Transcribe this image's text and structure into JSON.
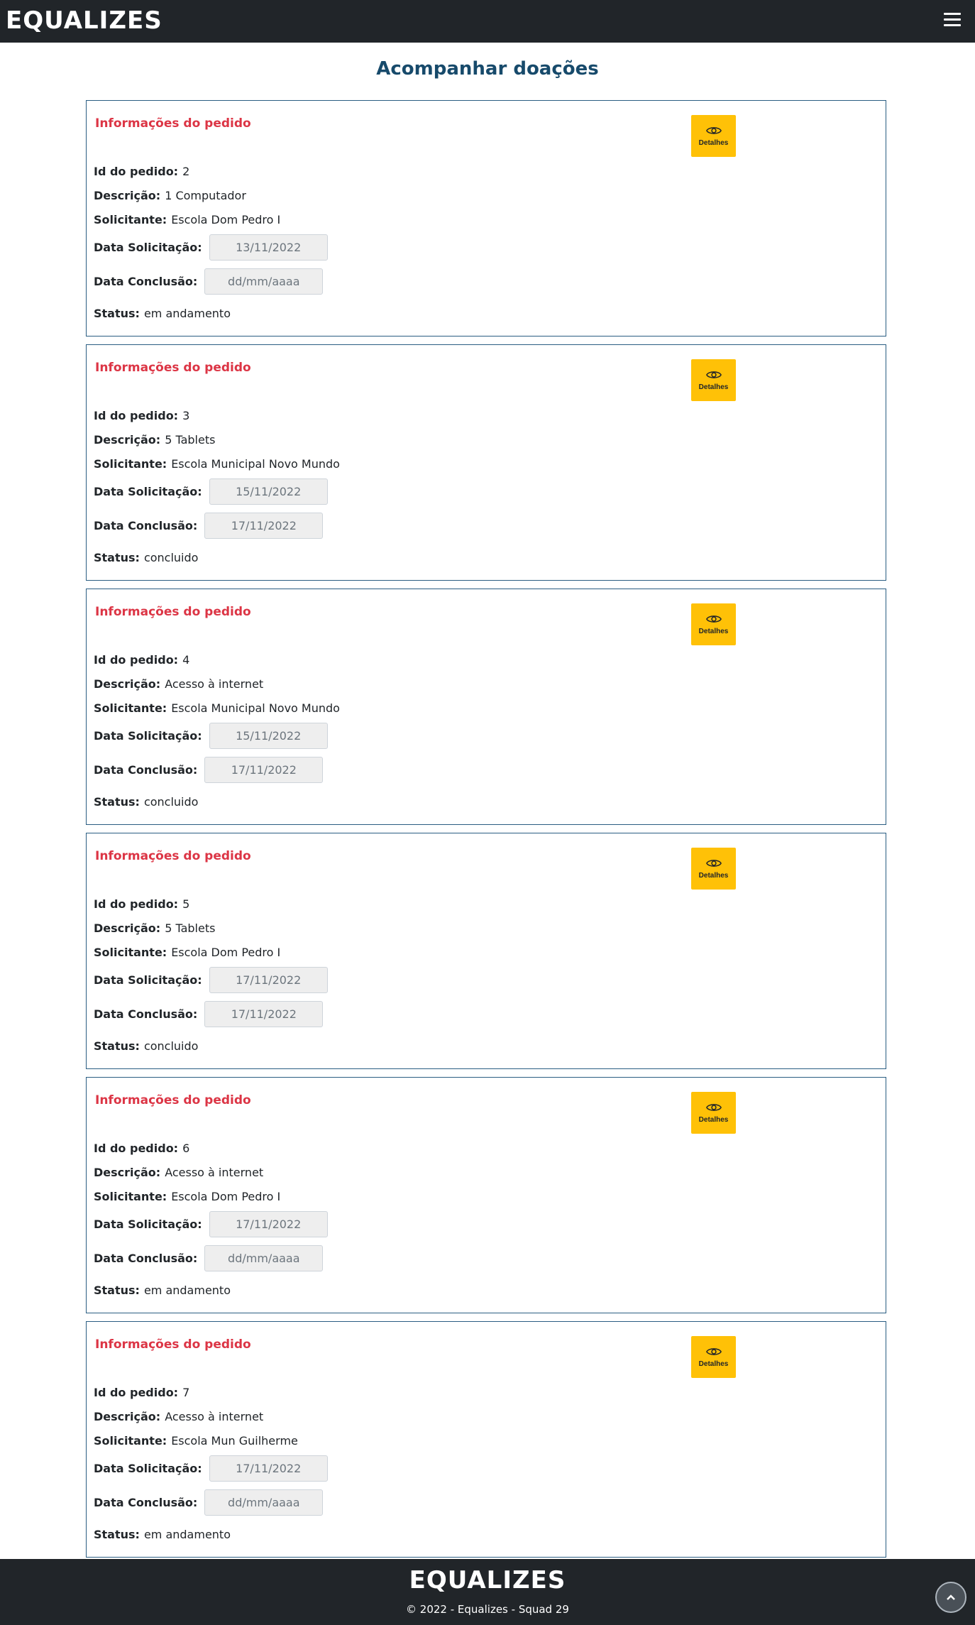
{
  "navbar": {
    "logo": "EQUALIZES",
    "menu_icon": "hamburger-icon"
  },
  "page": {
    "title": "Acompanhar doações"
  },
  "labels": {
    "section": "Informações do pedido",
    "details": "Detalhes",
    "id": "Id do pedido:",
    "desc": "Descrição:",
    "requester": "Solicitante:",
    "date_request": "Data Solicitação:",
    "date_conclusion": "Data Conclusão:",
    "status": "Status:"
  },
  "orders": [
    {
      "id": "2",
      "description": "1 Computador",
      "requester": "Escola Dom Pedro I",
      "date_request": "13/11/2022",
      "date_conclusion": "dd/mm/aaaa",
      "status": "em andamento"
    },
    {
      "id": "3",
      "description": "5 Tablets",
      "requester": "Escola Municipal Novo Mundo",
      "date_request": "15/11/2022",
      "date_conclusion": "17/11/2022",
      "status": "concluido"
    },
    {
      "id": "4",
      "description": "Acesso à internet",
      "requester": "Escola Municipal Novo Mundo",
      "date_request": "15/11/2022",
      "date_conclusion": "17/11/2022",
      "status": "concluido"
    },
    {
      "id": "5",
      "description": "5 Tablets",
      "requester": "Escola Dom Pedro I",
      "date_request": "17/11/2022",
      "date_conclusion": "17/11/2022",
      "status": "concluido"
    },
    {
      "id": "6",
      "description": "Acesso à internet",
      "requester": "Escola Dom Pedro I",
      "date_request": "17/11/2022",
      "date_conclusion": "dd/mm/aaaa",
      "status": "em andamento"
    },
    {
      "id": "7",
      "description": "Acesso à internet",
      "requester": "Escola Mun Guilherme",
      "date_request": "17/11/2022",
      "date_conclusion": "dd/mm/aaaa",
      "status": "em andamento"
    }
  ],
  "footer": {
    "logo": "EQUALIZES",
    "copyright": "© 2022 - Equalizes - Squad 29"
  },
  "colors": {
    "accent": "#dc3545",
    "title": "#174a6b",
    "button": "#ffc107",
    "dark": "#212529"
  }
}
